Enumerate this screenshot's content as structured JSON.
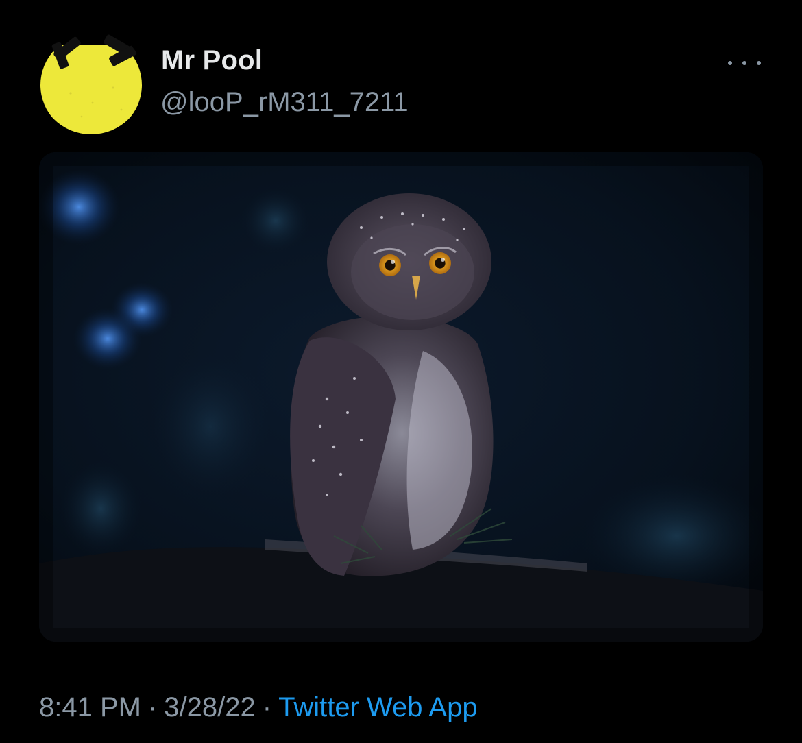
{
  "author": {
    "display_name": "Mr Pool",
    "handle": "@looP_rM311_7211",
    "avatar_icon": "yellow-face-avatar",
    "avatar_color": "#ede83a"
  },
  "more_icon": "more-options-icon",
  "media": {
    "description_icon": "owl-photo"
  },
  "metadata": {
    "time": "8:41 PM",
    "separator": "·",
    "date": "3/28/22",
    "client": "Twitter Web App"
  },
  "colors": {
    "background": "#000000",
    "primary_text": "#e7e9ea",
    "secondary_text": "#8b98a5",
    "link": "#1d9bf0"
  }
}
